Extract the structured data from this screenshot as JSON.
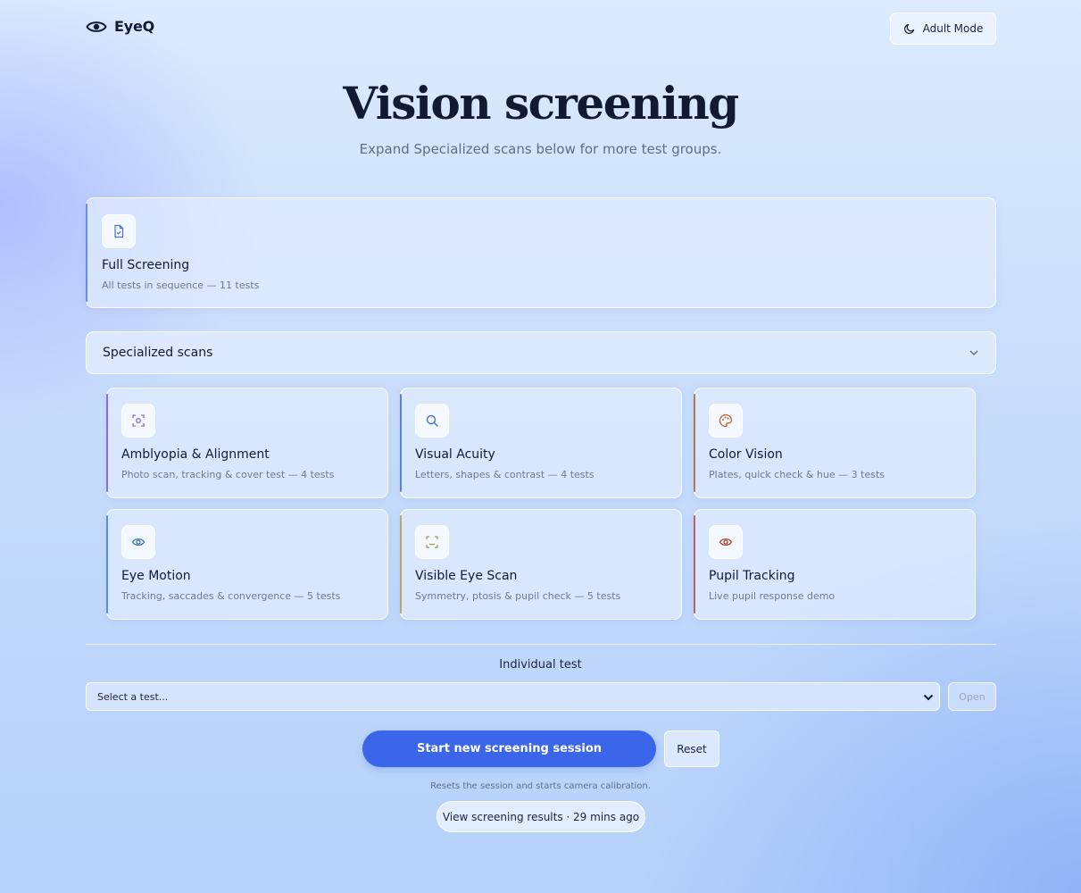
{
  "app": {
    "name": "EyeQ",
    "mode_label": "Adult Mode"
  },
  "hero": {
    "title": "Vision screening",
    "subtitle": "Expand Specialized scans below for more test groups."
  },
  "full_screening": {
    "title": "Full Screening",
    "desc": "All tests in sequence — 11 tests",
    "icon": "file-check-icon",
    "accent": "#6b8de8"
  },
  "specialized": {
    "label": "Specialized scans",
    "cards": [
      {
        "title": "Amblyopia & Alignment",
        "desc": "Photo scan, tracking & cover test — 4 tests",
        "icon": "scan-face-icon",
        "accent": "#8a6be0"
      },
      {
        "title": "Visual Acuity",
        "desc": "Letters, shapes & contrast — 4 tests",
        "icon": "search-icon",
        "accent": "#5b7fe0"
      },
      {
        "title": "Color Vision",
        "desc": "Plates, quick check & hue — 3 tests",
        "icon": "palette-icon",
        "accent": "#b0765a"
      },
      {
        "title": "Eye Motion",
        "desc": "Tracking, saccades & convergence — 5 tests",
        "icon": "eye-icon",
        "accent": "#5a8fd8"
      },
      {
        "title": "Visible Eye Scan",
        "desc": "Symmetry, ptosis & pupil check — 5 tests",
        "icon": "scan-icon",
        "accent": "#b8a66a"
      },
      {
        "title": "Pupil Tracking",
        "desc": "Live pupil response demo",
        "icon": "eye-red-icon",
        "accent": "#c0605a"
      }
    ]
  },
  "individual": {
    "label": "Individual test",
    "select_value": "Select a test...",
    "open_label": "Open"
  },
  "actions": {
    "start_label": "Start new screening session",
    "reset_label": "Reset",
    "hint": "Resets the session and starts camera calibration.",
    "results_label": "View screening results · 29 mins ago"
  }
}
